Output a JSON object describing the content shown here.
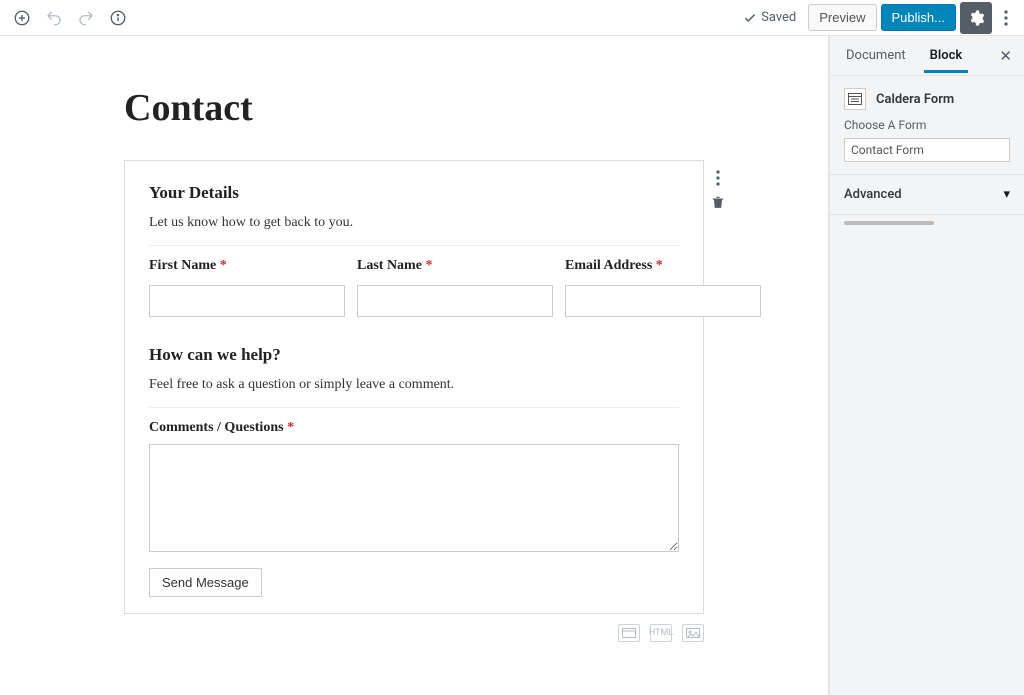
{
  "topbar": {
    "saved_label": "Saved",
    "preview_label": "Preview",
    "publish_label": "Publish..."
  },
  "editor": {
    "page_title": "Contact",
    "form": {
      "section1": {
        "heading": "Your Details",
        "description": "Let us know how to get back to you."
      },
      "fields": {
        "first_name_label": "First Name",
        "last_name_label": "Last Name",
        "email_label": "Email Address"
      },
      "section2": {
        "heading": "How can we help?",
        "description": "Feel free to ask a question or simply leave a comment."
      },
      "comments_label": "Comments / Questions",
      "submit_label": "Send Message",
      "required_marker": "*"
    }
  },
  "sidebar": {
    "tabs": {
      "document": "Document",
      "block": "Block"
    },
    "block_name": "Caldera Form",
    "choose_form_label": "Choose A Form",
    "selected_form": "Contact Form",
    "advanced_label": "Advanced"
  }
}
